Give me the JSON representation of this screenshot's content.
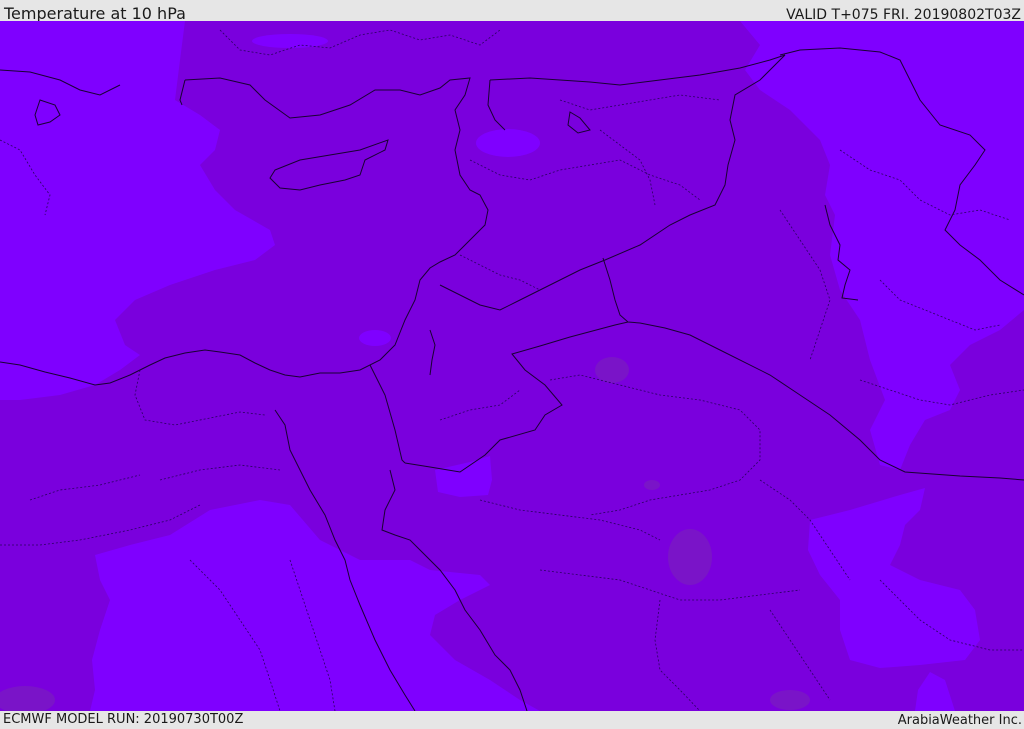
{
  "header": {
    "title": "Temperature at 10 hPa",
    "valid_time": "VALID T+075 FRI. 20190802T03Z"
  },
  "footer": {
    "model_run": "ECMWF MODEL RUN: 20190730T00Z",
    "credit": "ArabiaWeather Inc."
  },
  "colors": {
    "field_dark": "#7a00dd",
    "field_light": "#7f00ff",
    "field_muted": "#7a14c8",
    "border": "#1a0033"
  }
}
